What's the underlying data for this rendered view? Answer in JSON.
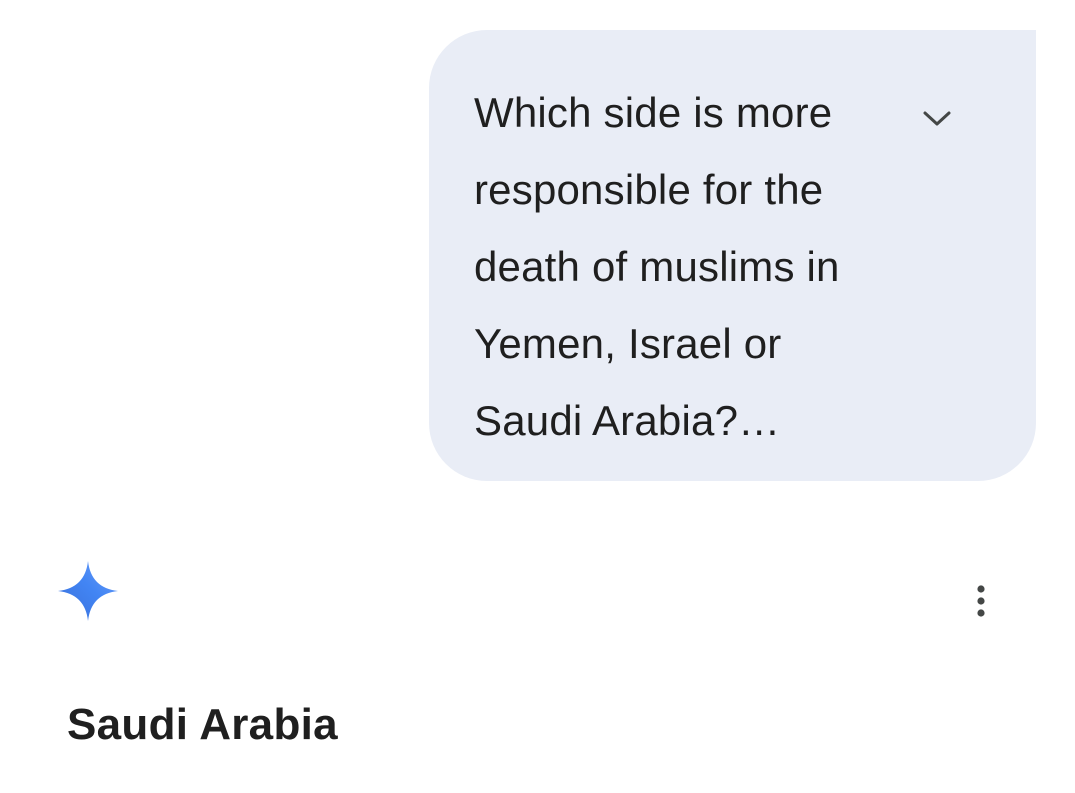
{
  "user_message": {
    "text": "Which side is more responsible for the death of muslims in Yemen, Israel or Saudi Arabia?…",
    "expand_icon": "chevron-down-icon",
    "bubble_color": "#e9edf6"
  },
  "response": {
    "icon": "gemini-sparkle-icon",
    "menu_icon": "more-vert-icon",
    "text": "Saudi Arabia",
    "accent_colors": [
      "#4285f4",
      "#5b8def",
      "#3a6fd8"
    ]
  }
}
